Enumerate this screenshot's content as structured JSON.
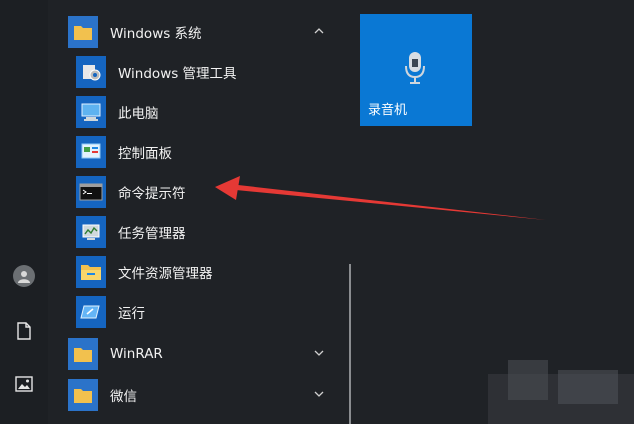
{
  "start_menu": {
    "sections": [
      {
        "label": "Windows 系统",
        "expanded": true,
        "icon": "folder-icon"
      },
      {
        "label": "WinRAR",
        "expanded": false,
        "icon": "folder-icon"
      },
      {
        "label": "微信",
        "expanded": false,
        "icon": "folder-icon"
      }
    ],
    "windows_system_items": [
      {
        "label": "Windows 管理工具",
        "icon": "admin-tools-icon"
      },
      {
        "label": "此电脑",
        "icon": "this-pc-icon"
      },
      {
        "label": "控制面板",
        "icon": "control-panel-icon"
      },
      {
        "label": "命令提示符",
        "icon": "command-prompt-icon"
      },
      {
        "label": "任务管理器",
        "icon": "task-manager-icon"
      },
      {
        "label": "文件资源管理器",
        "icon": "file-explorer-icon"
      },
      {
        "label": "运行",
        "icon": "run-icon"
      }
    ]
  },
  "tiles": [
    {
      "label": "录音机",
      "icon": "microphone-icon",
      "color": "#0a78d4"
    }
  ],
  "rail": {
    "items": [
      "user-avatar-icon",
      "document-icon",
      "pictures-icon"
    ]
  },
  "colors": {
    "background": "#1f2226",
    "accent": "#0a78d4",
    "folder": "#f2c14e",
    "arrow": "#e53935"
  }
}
